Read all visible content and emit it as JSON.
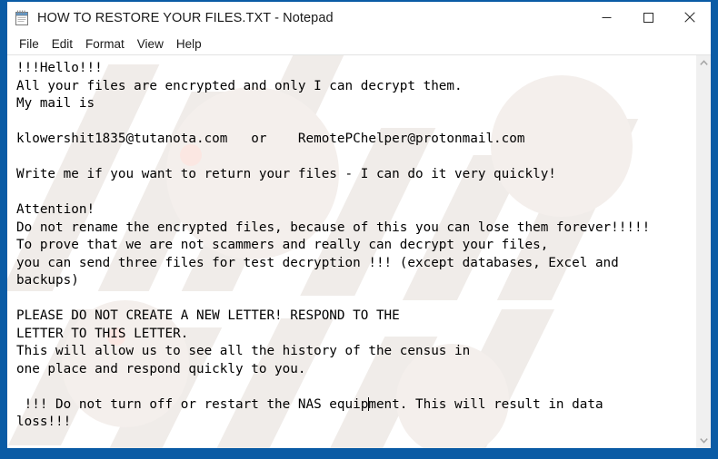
{
  "window": {
    "title": "HOW TO RESTORE YOUR FILES.TXT - Notepad",
    "app_icon": "notepad-icon",
    "border_color": "#0a5ba5",
    "controls": {
      "minimize": "minimize-icon",
      "maximize": "maximize-icon",
      "close": "close-icon"
    }
  },
  "menubar": {
    "items": [
      {
        "label": "File"
      },
      {
        "label": "Edit"
      },
      {
        "label": "Format"
      },
      {
        "label": "View"
      },
      {
        "label": "Help"
      }
    ]
  },
  "editor": {
    "lines_before_caret": "!!!Hello!!!\nAll your files are encrypted and only I can decrypt them.\nMy mail is\n\nklowershit1835@tutanota.com   or    RemotePChelper@protonmail.com\n\nWrite me if you want to return your files - I can do it very quickly!\n\nAttention!\nDo not rename the encrypted files, because of this you can lose them forever!!!!!\nTo prove that we are not scammers and really can decrypt your files,\nyou can send three files for test decryption !!! (except databases, Excel and\nbackups)\n\nPLEASE DO NOT CREATE A NEW LETTER! RESPOND TO THE\nLETTER TO THIS LETTER.\nThis will allow us to see all the history of the census in\none place and respond quickly to you.\n\n !!! Do not turn off or restart the NAS equip",
    "lines_after_caret": "ment. This will result in data\nloss!!!",
    "emails": [
      "klowershit1835@tutanota.com",
      "RemotePChelper@protonmail.com"
    ],
    "caret_present": true
  },
  "scrollbar": {
    "up_arrow": "chevron-up-icon",
    "down_arrow": "chevron-down-icon"
  }
}
